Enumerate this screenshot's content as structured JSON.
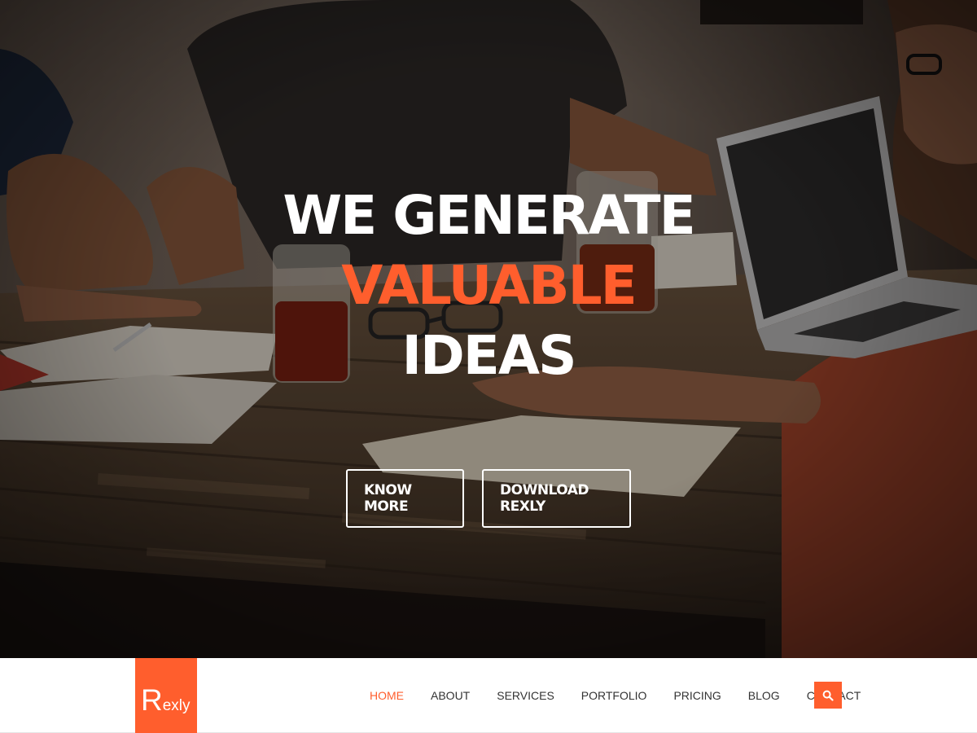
{
  "hero": {
    "title_line1": "WE GENERATE",
    "title_line2": "VALUABLE",
    "title_line3": "IDEAS",
    "buttons": {
      "know_more": "KNOW MORE",
      "download": "DOWNLOAD REXLY"
    }
  },
  "navbar": {
    "logo": {
      "initial": "R",
      "rest": "exly"
    },
    "items": [
      {
        "label": "HOME",
        "active": true
      },
      {
        "label": "ABOUT",
        "active": false
      },
      {
        "label": "SERVICES",
        "active": false
      },
      {
        "label": "PORTFOLIO",
        "active": false
      },
      {
        "label": "PRICING",
        "active": false
      },
      {
        "label": "BLOG",
        "active": false
      },
      {
        "label": "CONTACT",
        "active": false
      }
    ],
    "search_icon": "search-icon"
  },
  "colors": {
    "accent": "#ff5e2d",
    "hero_text": "#ffffff",
    "nav_text": "#333333"
  }
}
